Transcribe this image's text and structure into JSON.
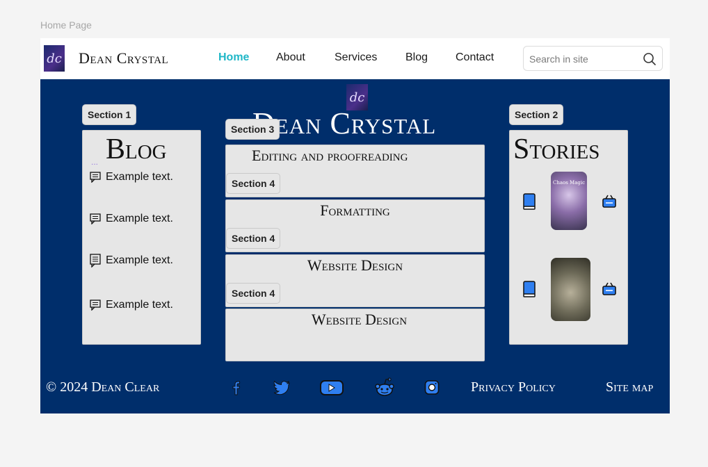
{
  "page_label": "Home Page",
  "header": {
    "logo_letters": "dc",
    "brand": "Dean Crystal",
    "nav": [
      {
        "label": "Home",
        "active": true
      },
      {
        "label": "About"
      },
      {
        "label": "Services"
      },
      {
        "label": "Blog"
      },
      {
        "label": "Contact"
      }
    ],
    "search": {
      "placeholder": "Search in site",
      "icon": "search-icon"
    }
  },
  "hero": {
    "logo_letters": "dc",
    "title": "Dean Crystal"
  },
  "sections": {
    "s1": "Section 1",
    "s2": "Section 2",
    "s3": "Section 3",
    "s4": "Section 4"
  },
  "blog": {
    "title": "Blog",
    "dots": "...",
    "items": [
      "Example text.",
      "Example text.",
      "Example text.",
      "Example text."
    ],
    "item_icon": "comment-icon"
  },
  "services": [
    "Editing and proofreading",
    "Formatting",
    "Website Design",
    "Website Design"
  ],
  "stories": {
    "title": "Stories",
    "cover1_text": "Chaos Magic",
    "icons": [
      "book-icon",
      "basket-icon"
    ]
  },
  "footer": {
    "copyright": "© 2024 Dean Clear",
    "social": [
      "facebook-icon",
      "twitter-icon",
      "youtube-icon",
      "reddit-icon",
      "instagram-icon"
    ],
    "privacy": "Privacy Policy",
    "sitemap": "Site map"
  },
  "colors": {
    "accent": "#1fb7c7",
    "main_bg": "#002e6b",
    "panel_bg": "#e6e6e6",
    "icon_blue": "#2f7ff0"
  }
}
